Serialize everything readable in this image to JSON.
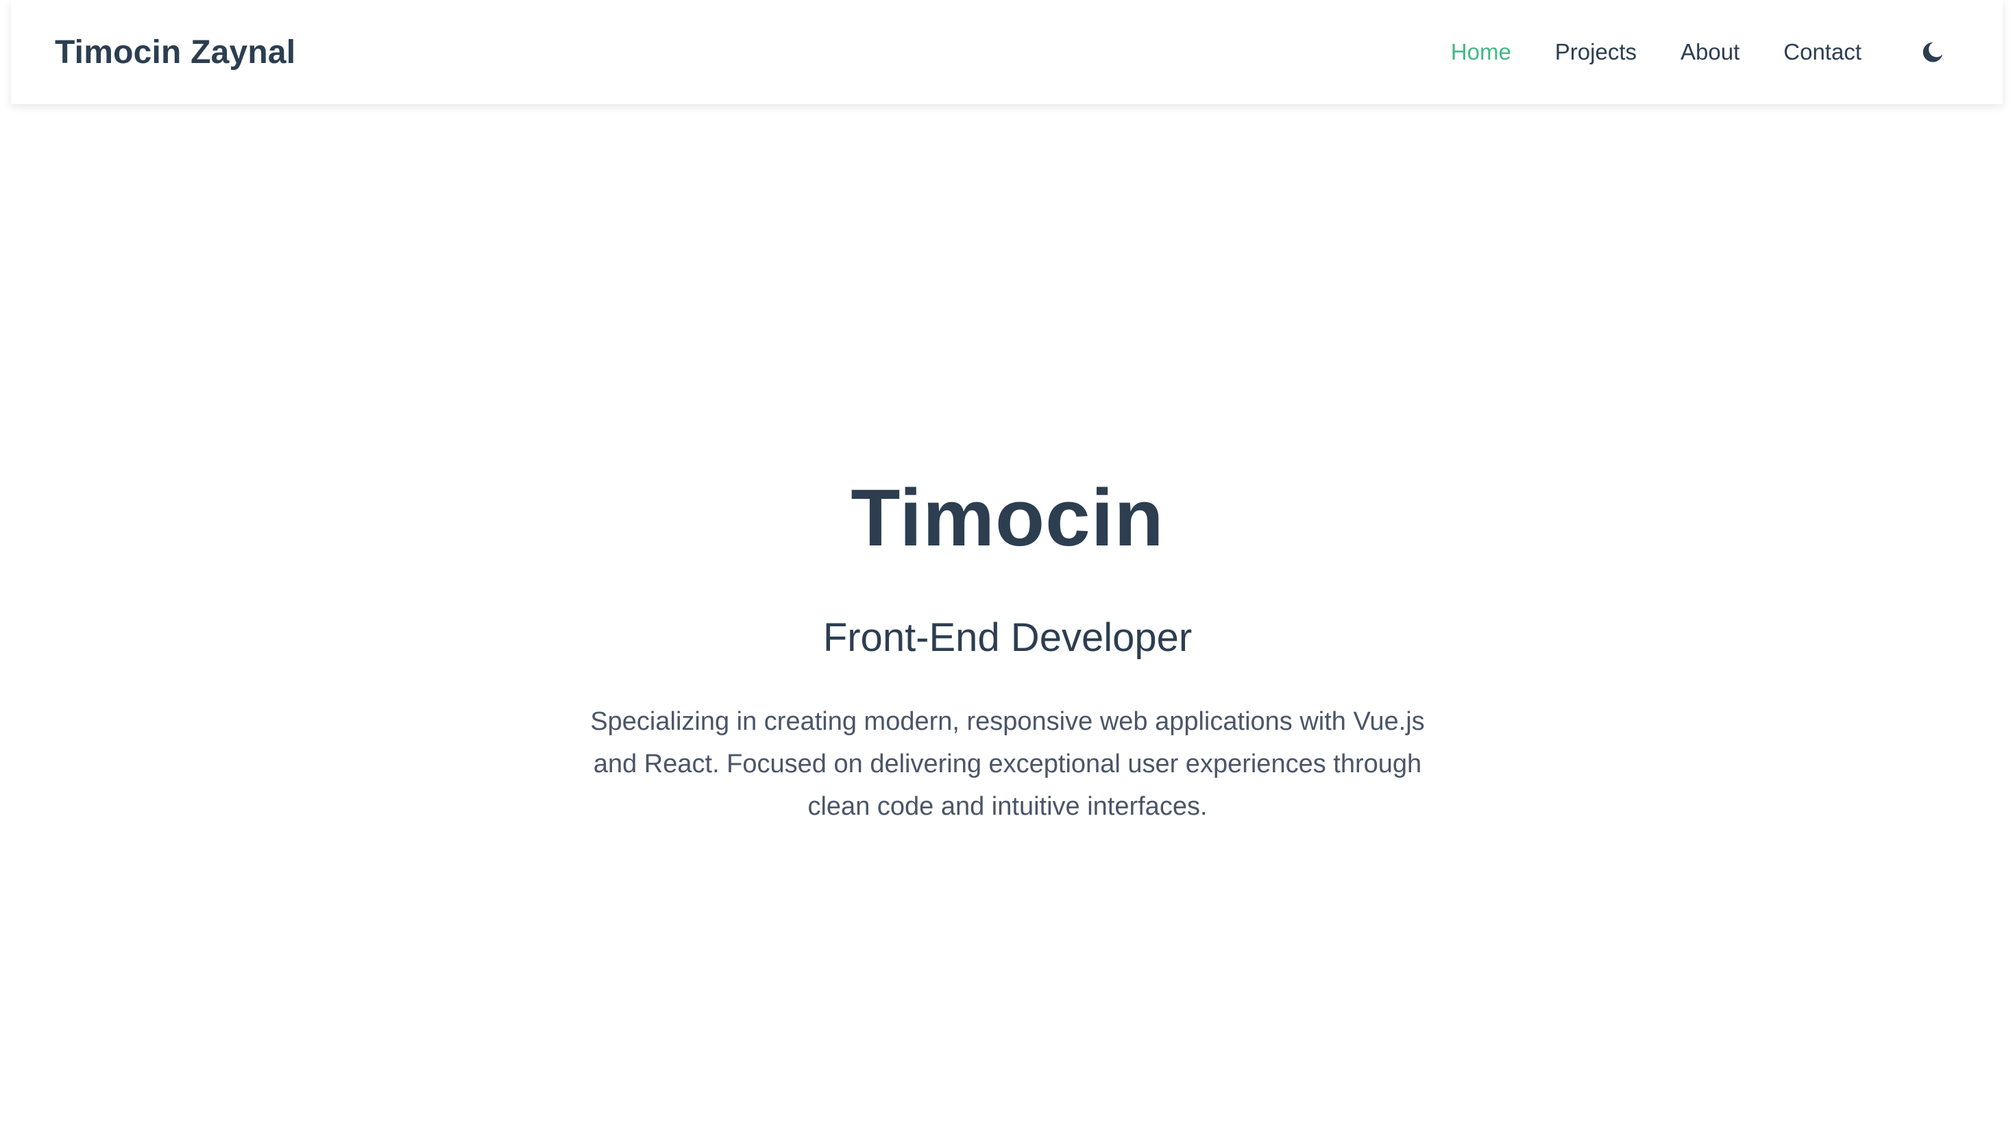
{
  "navbar": {
    "brand": "Timocin Zaynal",
    "links": [
      {
        "label": "Home",
        "active": true
      },
      {
        "label": "Projects",
        "active": false
      },
      {
        "label": "About",
        "active": false
      },
      {
        "label": "Contact",
        "active": false
      }
    ],
    "theme_toggle_icon": "moon-icon"
  },
  "hero": {
    "title": "Timocin",
    "subtitle": "Front-End Developer",
    "description": "Specializing in creating modern, responsive web applications with Vue.js and React. Focused on delivering exceptional user experiences through clean code and intuitive interfaces."
  },
  "colors": {
    "text": "#2c3e50",
    "accent": "#42b983",
    "muted": "#4a5568",
    "background": "#ffffff"
  }
}
